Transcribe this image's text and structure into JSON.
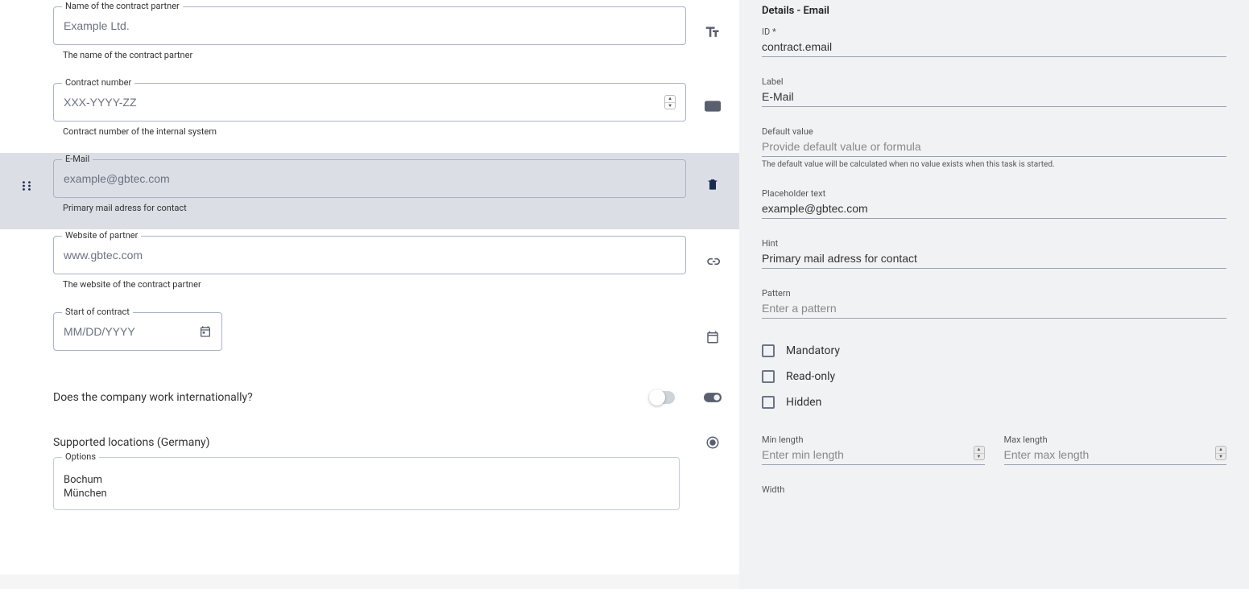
{
  "left": {
    "fields": [
      {
        "label": "Name of the contract partner",
        "placeholder": "Example Ltd.",
        "hint": "The name of the contract partner",
        "type": "text"
      },
      {
        "label": "Contract number",
        "placeholder": "XXX-YYYY-ZZ",
        "hint": "Contract number of the internal system",
        "type": "number"
      },
      {
        "label": "E-Mail",
        "placeholder": "example@gbtec.com",
        "hint": "Primary mail adress for contact",
        "type": "email"
      },
      {
        "label": "Website of partner",
        "placeholder": "www.gbtec.com",
        "hint": "The website of the contract partner",
        "type": "url"
      },
      {
        "label": "Start of contract",
        "placeholder": "MM/DD/YYYY",
        "hint": "",
        "type": "date"
      }
    ],
    "question": "Does the company work internationally?",
    "locations_header": "Supported locations (Germany)",
    "options_label": "Options",
    "options": [
      "Bochum",
      "München"
    ]
  },
  "right": {
    "title": "Details - Email",
    "id_label": "ID *",
    "id_value": "contract.email",
    "label_label": "Label",
    "label_value": "E-Mail",
    "default_label": "Default value",
    "default_placeholder": "Provide default value or formula",
    "default_hint": "The default value will be calculated when no value exists when this task is started.",
    "placeholder_label": "Placeholder text",
    "placeholder_value": "example@gbtec.com",
    "hint_label": "Hint",
    "hint_value": "Primary mail adress for contact",
    "pattern_label": "Pattern",
    "pattern_placeholder": "Enter a pattern",
    "checks": [
      "Mandatory",
      "Read-only",
      "Hidden"
    ],
    "minlength_label": "Min length",
    "minlength_placeholder": "Enter min length",
    "maxlength_label": "Max length",
    "maxlength_placeholder": "Enter max length",
    "width_label": "Width"
  }
}
